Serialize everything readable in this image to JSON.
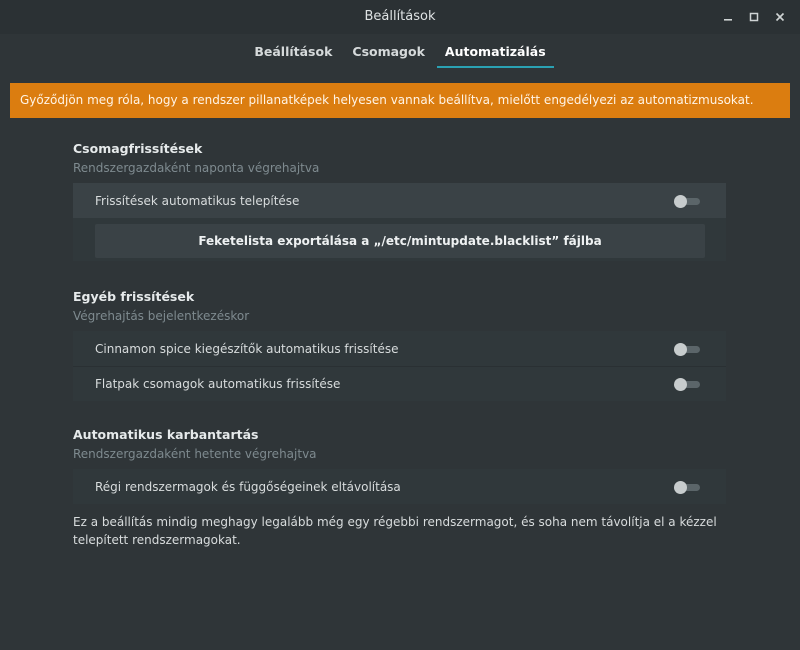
{
  "window": {
    "title": "Beállítások",
    "controls": [
      "minimize-icon",
      "maximize-icon",
      "close-icon"
    ]
  },
  "tabs": [
    {
      "label": "Beállítások",
      "active": false
    },
    {
      "label": "Csomagok",
      "active": false
    },
    {
      "label": "Automatizálás",
      "active": true
    }
  ],
  "banner": {
    "text": "Győződjön meg róla, hogy a rendszer pillanatképek helyesen vannak beállítva, mielőtt engedélyezi az automatizmusokat.",
    "color": "#db7d10"
  },
  "sections": {
    "package_updates": {
      "title": "Csomagfrissítések",
      "subtitle": "Rendszergazdaként naponta végrehajtva",
      "rows": [
        {
          "label": "Frissítések automatikus telepítése",
          "enabled": false
        }
      ],
      "export_button": "Feketelista exportálása a „/etc/mintupdate.blacklist” fájlba"
    },
    "other_updates": {
      "title": "Egyéb frissítések",
      "subtitle": "Végrehajtás bejelentkezéskor",
      "rows": [
        {
          "label": "Cinnamon spice kiegészítők automatikus frissítése",
          "enabled": false
        },
        {
          "label": "Flatpak csomagok automatikus frissítése",
          "enabled": false
        }
      ]
    },
    "maintenance": {
      "title": "Automatikus karbantartás",
      "subtitle": "Rendszergazdaként hetente végrehajtva",
      "rows": [
        {
          "label": "Régi rendszermagok és függőségeinek eltávolítása",
          "enabled": false
        }
      ],
      "note": "Ez a beállítás mindig meghagy legalább még egy régebbi rendszermagot, és soha nem távolítja el a kézzel telepített rendszermagokat."
    }
  },
  "accent_color": "#2aa1b3"
}
